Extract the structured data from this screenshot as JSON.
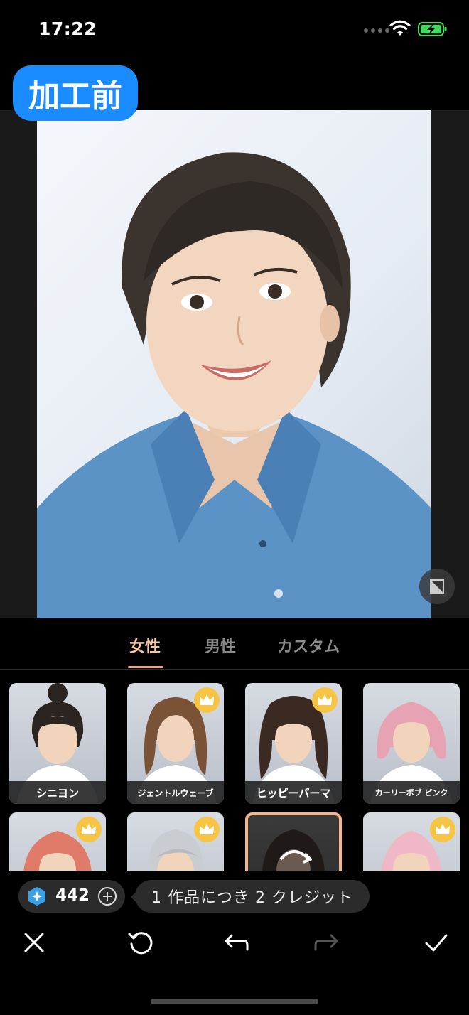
{
  "status_bar": {
    "time": "17:22"
  },
  "badge": {
    "label": "加工前"
  },
  "tabs": [
    {
      "label": "女性",
      "active": true
    },
    {
      "label": "男性",
      "active": false
    },
    {
      "label": "カスタム",
      "active": false
    }
  ],
  "hairstyles": [
    {
      "label": "シニヨン",
      "premium": false,
      "selected": false
    },
    {
      "label": "ジェントルウェーブ",
      "premium": true,
      "selected": false
    },
    {
      "label": "ヒッピーパーマ",
      "premium": true,
      "selected": false
    },
    {
      "label": "カーリーボブ ピンク",
      "premium": false,
      "selected": false
    },
    {
      "label": "",
      "premium": true,
      "selected": false
    },
    {
      "label": "",
      "premium": true,
      "selected": false
    },
    {
      "label": "",
      "premium": false,
      "selected": true
    },
    {
      "label": "",
      "premium": true,
      "selected": false
    }
  ],
  "credits": {
    "count": "442",
    "cost_text": "1 作品につき 2 クレジット"
  },
  "toolbar": {
    "close": "close-icon",
    "reset": "reset-icon",
    "undo": "undo-icon",
    "redo": "redo-icon",
    "confirm": "check-icon"
  },
  "colors": {
    "accent": "#1a8cff",
    "tab_active": "#f5c8a0",
    "crown": "#f7c543",
    "selected_border": "#f7b58a"
  }
}
